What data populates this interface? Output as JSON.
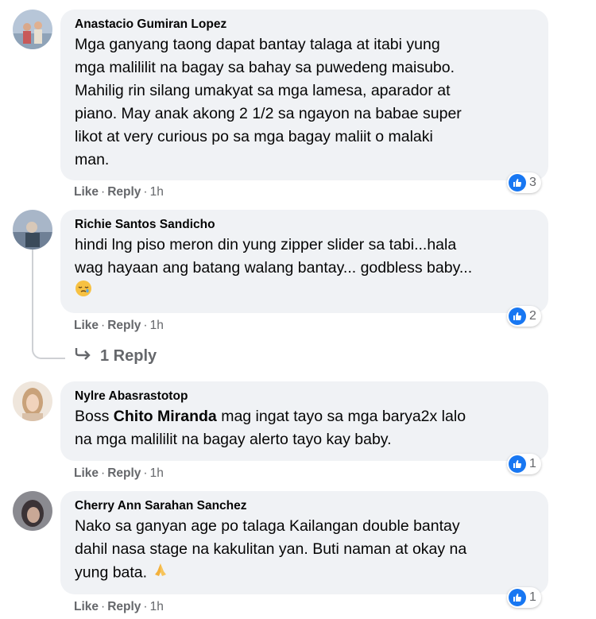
{
  "comments": [
    {
      "author": "Anastacio Gumiran Lopez",
      "lines": [
        "Mga ganyang taong dapat bantay talaga at itabi yung",
        "mga malililit na bagay sa bahay sa puwedeng maisubo.",
        "Mahilig rin silang umakyat sa mga lamesa, aparador at",
        "piano. May anak akong 2 1/2 sa ngayon na babae super",
        "likot at very curious po sa mga bagay maliit o malaki",
        "man."
      ],
      "like_label": "Like",
      "reply_label": "Reply",
      "time": "1h",
      "reaction_count": "3"
    },
    {
      "author": "Richie Santos Sandicho",
      "lines": [
        "hindi lng piso meron din yung zipper slider sa tabi...hala",
        "wag hayaan ang batang walang bantay... godbless baby..."
      ],
      "emoji": "sleepy-face",
      "like_label": "Like",
      "reply_label": "Reply",
      "time": "1h",
      "reaction_count": "2",
      "replies_link": "1 Reply"
    },
    {
      "author": "Nylre Abasrastotop",
      "line1_prefix": "Boss ",
      "mention": "Chito Miranda",
      "line1_suffix": " mag ingat tayo sa mga barya2x lalo",
      "line2": "na mga malililit na bagay alerto tayo kay baby.",
      "like_label": "Like",
      "reply_label": "Reply",
      "time": "1h",
      "reaction_count": "1"
    },
    {
      "author": "Cherry Ann Sarahan Sanchez",
      "lines": [
        "Nako sa ganyan age po talaga Kailangan double bantay",
        "dahil nasa stage na kakulitan yan. Buti naman at okay na",
        "yung bata."
      ],
      "emoji": "folded-hands",
      "like_label": "Like",
      "reply_label": "Reply",
      "time": "1h",
      "reaction_count": "1"
    }
  ],
  "colors": {
    "bubble": "#f0f2f5",
    "meta": "#65676b",
    "like_blue": "#1877f2",
    "text": "#050505"
  }
}
